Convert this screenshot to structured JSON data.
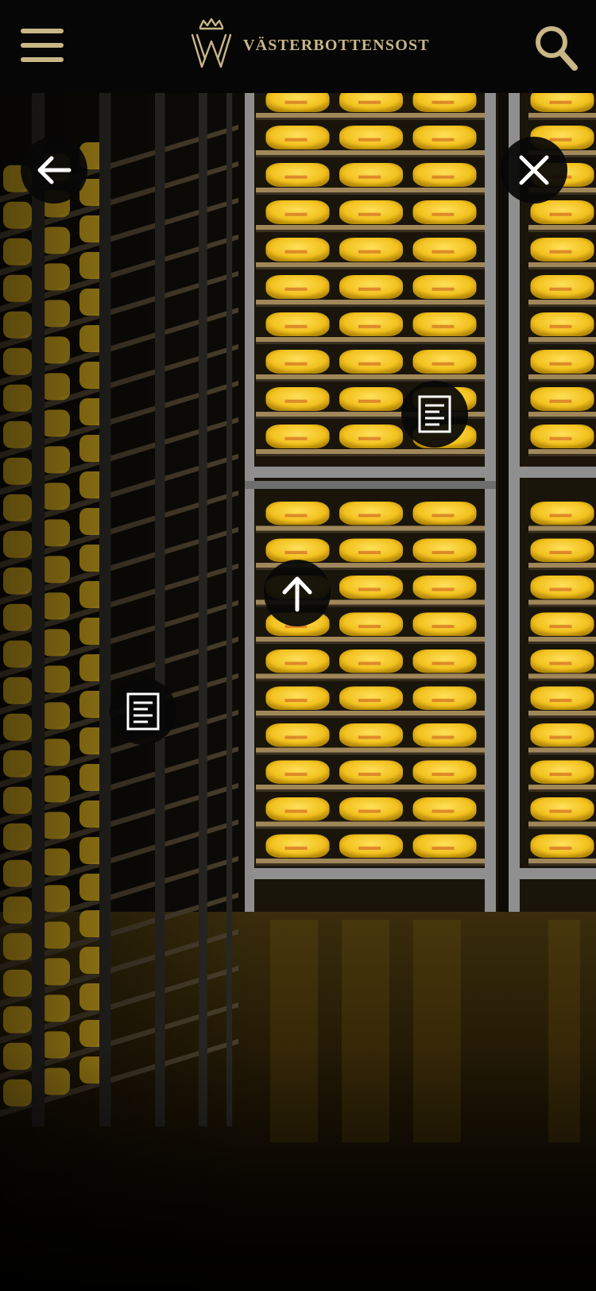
{
  "header": {
    "brand": "VÄSTERBOTTENSOST",
    "brand_mark": "crowned-w-logo",
    "menu_icon": "hamburger-menu-icon",
    "search_icon": "search-icon",
    "accent_color": "#c9b687"
  },
  "photo": {
    "subject": "cheese-storage-racks-image"
  },
  "overlay": {
    "back_icon": "arrow-left-icon",
    "close_icon": "close-icon",
    "up_icon": "arrow-up-icon",
    "hotspot_icon": "document-icon"
  }
}
